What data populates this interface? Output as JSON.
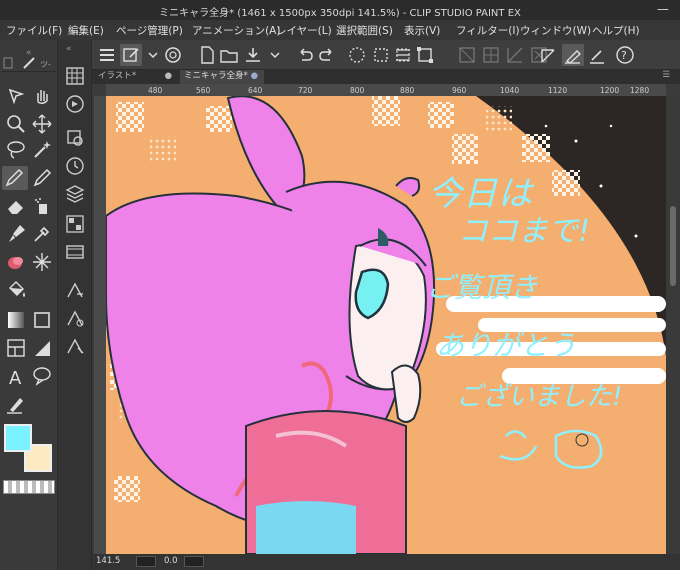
{
  "window": {
    "title": "ミニキャラ全身* (1461 x 1500px 350dpi 141.5%) - CLIP STUDIO PAINT EX",
    "minimize": "—",
    "maximize": "☐"
  },
  "menu": [
    "ファイル(F)",
    "編集(E)",
    "ページ管理(P)",
    "アニメーション(A)",
    "レイヤー(L)",
    "選択範囲(S)",
    "表示(V)",
    "フィルター(I)",
    "ウィンドウ(W)",
    "ヘルプ(H)"
  ],
  "tabs": [
    {
      "label": "イラスト*",
      "active": false
    },
    {
      "label": "ミニキャラ全身*",
      "active": true
    }
  ],
  "ruler_labels": [
    "480",
    "560",
    "640",
    "720",
    "800",
    "880",
    "960",
    "1040",
    "1120",
    "1200",
    "1280"
  ],
  "status": {
    "zoom": "141.5",
    "angle": "0.0"
  },
  "colors": {
    "main": "#7af2ff",
    "sub": "#fde9c2",
    "accent": "#f4ae6f"
  },
  "panel_headers": {
    "left_short": "-",
    "left_tab": "ツ-"
  },
  "canvas_text": {
    "line1": "今日は",
    "line2": "ココまで!",
    "line3": "ご覧頂き",
    "line4": "ありがとう",
    "line5": "ございました!"
  }
}
